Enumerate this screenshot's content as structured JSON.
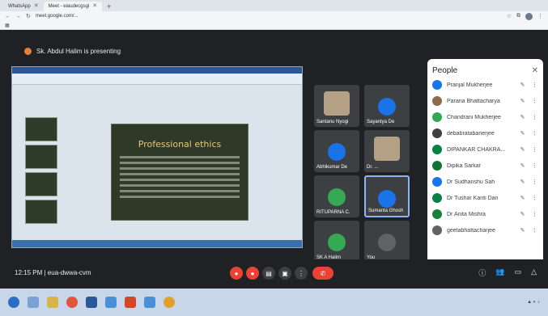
{
  "browser": {
    "tabs": [
      {
        "label": "WhatsApp",
        "active": false
      },
      {
        "label": "Meet - eiaudecgsgi",
        "active": true
      }
    ],
    "url": "meet.google.com/..."
  },
  "meet": {
    "presenter_banner": "Sk. Abdul Halim is presenting",
    "time": "12:15 PM",
    "meeting_code": "eua-dwwa-cvm",
    "tiles": [
      {
        "name": "Santanu Nyogi",
        "color": "#5f6368"
      },
      {
        "name": "Sayantya De",
        "color": "#1a73e8"
      },
      {
        "name": "Abhikumar De",
        "color": "#1a73e8"
      },
      {
        "name": "Dr. ...",
        "color": "#b3a085"
      },
      {
        "name": "RITUPARNA C.",
        "color": "#34a853"
      },
      {
        "name": "Sumanta Ghosh",
        "color": "#1a73e8"
      },
      {
        "name": "SK A Halim",
        "color": "#34a853"
      },
      {
        "name": "You",
        "color": "#5f6368"
      }
    ]
  },
  "slide": {
    "title": "Professional ethics"
  },
  "people": {
    "title": "People",
    "list": [
      {
        "name": "Pranjal Mukherjee",
        "color": "#1a73e8"
      },
      {
        "name": "Parana Bhattacharya",
        "color": "#8e6b4a"
      },
      {
        "name": "Chandrani Mukherjee",
        "color": "#34a853"
      },
      {
        "name": "debabratabanerjee",
        "color": "#3c4043"
      },
      {
        "name": "DIPANKAR CHAKRA...",
        "color": "#0b8043"
      },
      {
        "name": "Dipika Sarkar",
        "color": "#137333"
      },
      {
        "name": "Dr Sudhanshu Sah",
        "color": "#1a73e8"
      },
      {
        "name": "Dr Tushar Kanti Dan",
        "color": "#0b8043"
      },
      {
        "name": "Dr Anita Mishra",
        "color": "#188038"
      },
      {
        "name": "geetabhattacharjee",
        "color": "#5f6368"
      }
    ]
  }
}
